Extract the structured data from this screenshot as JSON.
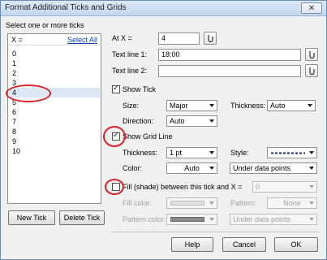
{
  "window": {
    "title": "Format Additional Ticks and Grids",
    "close_glyph": "✕"
  },
  "left": {
    "caption": "Select one or more ticks",
    "list_header": "X =",
    "select_all": "Select All",
    "ticks": [
      "0",
      "1",
      "2",
      "3",
      "4",
      "5",
      "6",
      "7",
      "8",
      "9",
      "10"
    ],
    "selected_tick": "4",
    "new_tick": "New Tick",
    "delete_tick": "Delete Tick"
  },
  "right": {
    "at_label": "At X =",
    "at_value": "4",
    "text1_label": "Text line 1:",
    "text1_value": "18:00",
    "text2_label": "Text line 2:",
    "text2_value": "",
    "show_tick_label": "Show Tick",
    "show_tick_checked": true,
    "size_label": "Size:",
    "size_value": "Major",
    "thickness_label": "Thickness:",
    "tick_thickness_value": "Auto",
    "direction_label": "Direction:",
    "direction_value": "Auto",
    "show_grid_label": "Show Grid Line",
    "show_grid_checked": true,
    "grid_thickness_label": "Thickness:",
    "grid_thickness_value": "1 pt",
    "style_label": "Style:",
    "color_label": "Color:",
    "color_value": "Auto",
    "layer_value": "Under data points",
    "fill_label": "Fill (shade) between this tick and X =",
    "fill_value": "0",
    "fill_checked": false,
    "fill_color_label": "Fill color:",
    "pattern_label": "Pattern:",
    "pattern_value": "None",
    "pattern_color_label": "Pattern color:",
    "fill_layer_value": "Under data points"
  },
  "buttons": {
    "help": "Help",
    "cancel": "Cancel",
    "ok": "OK"
  }
}
